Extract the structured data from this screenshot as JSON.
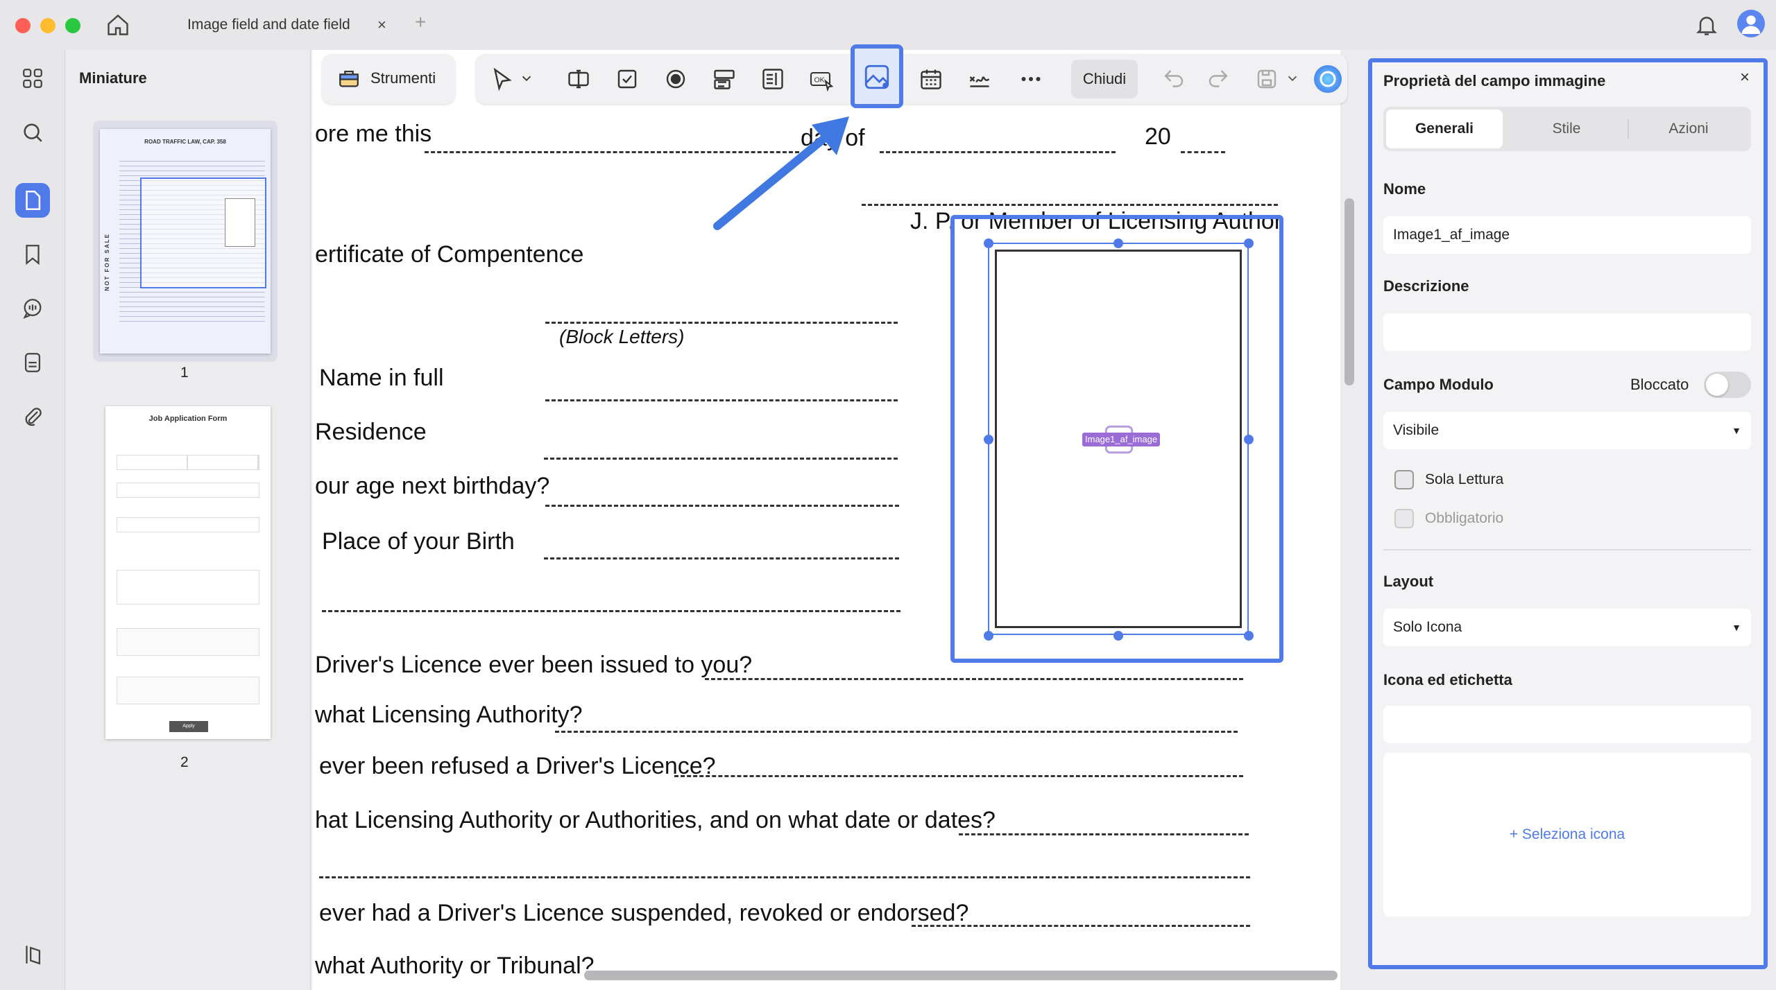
{
  "window": {
    "tab_title": "Image field and date field",
    "tab_close": "×",
    "new_tab": "+"
  },
  "thumbnails": {
    "title": "Miniature",
    "pages": [
      {
        "label": "1",
        "heading": "ROAD TRAFFIC LAW, CAP. 358",
        "side_text": "NOT FOR SALE"
      },
      {
        "label": "2",
        "heading": "Job Application Form",
        "submit": "Apply"
      }
    ]
  },
  "toolbar": {
    "tools_label": "Strumenti",
    "close_label": "Chiudi",
    "ok_label": "OK"
  },
  "document": {
    "lines": [
      "ore me this",
      "day of",
      "20",
      "J. P. or Member of Licensing Author",
      "ertificate of Compentence",
      "(Block Letters)",
      "Name in full",
      "Residence",
      "our age next birthday?",
      "Place of your Birth",
      "Driver's Licence ever been issued to you?",
      "what Licensing Authority?",
      "ever been refused a Driver's Licence?",
      "hat Licensing Authority or Authorities, and on what date or dates?",
      "ever had a Driver's Licence suspended, revoked or endorsed?",
      "what Authority or Tribunal?"
    ],
    "image_field_tag": "Image1_af_image"
  },
  "properties": {
    "title": "Proprietà del campo immagine",
    "tabs": [
      "Generali",
      "Stile",
      "Azioni"
    ],
    "active_tab": "Generali",
    "name_label": "Nome",
    "name_value": "Image1_af_image",
    "description_label": "Descrizione",
    "description_value": "",
    "form_field_label": "Campo Modulo",
    "locked_label": "Bloccato",
    "locked": false,
    "visibility_value": "Visibile",
    "read_only_label": "Sola Lettura",
    "required_label": "Obbligatorio",
    "layout_label": "Layout",
    "layout_value": "Solo Icona",
    "icon_label_title": "Icona ed etichetta",
    "icon_label_value": "",
    "select_icon": "+ Seleziona icona"
  },
  "colors": {
    "accent": "#4f7ae8",
    "arrow": "#3f78e0",
    "tag": "#9b6bd6"
  }
}
